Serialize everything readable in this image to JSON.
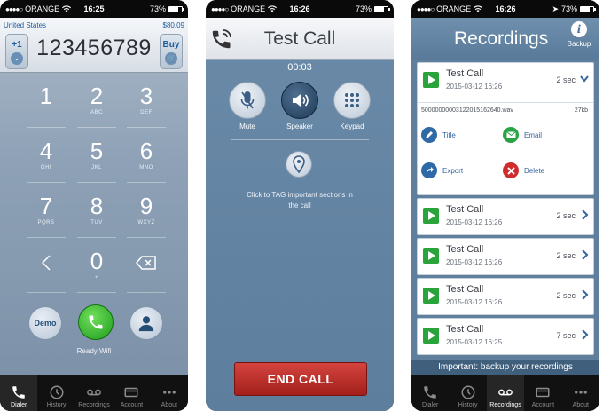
{
  "status_bars": [
    {
      "carrier": "ORANGE",
      "time": "16:25",
      "battery": "73%"
    },
    {
      "carrier": "ORANGE",
      "time": "16:26",
      "battery": "73%"
    },
    {
      "carrier": "ORANGE",
      "time": "16:26",
      "battery": "73%"
    }
  ],
  "dialer": {
    "country": "United States",
    "balance": "$80.09",
    "country_code": "+1",
    "buy_label": "Buy",
    "number": "123456789",
    "keys": [
      {
        "digit": "1",
        "letters": ""
      },
      {
        "digit": "2",
        "letters": "ABC"
      },
      {
        "digit": "3",
        "letters": "DEF"
      },
      {
        "digit": "4",
        "letters": "GHI"
      },
      {
        "digit": "5",
        "letters": "JKL"
      },
      {
        "digit": "6",
        "letters": "MNO"
      },
      {
        "digit": "7",
        "letters": "PQRS"
      },
      {
        "digit": "8",
        "letters": "TUV"
      },
      {
        "digit": "9",
        "letters": "WXYZ"
      },
      {
        "digit": "0",
        "letters": "+"
      }
    ],
    "demo_label": "Demo",
    "status_text": "Ready Wifi"
  },
  "tabbar_dialer": [
    "Dialer",
    "History",
    "Recordings",
    "Account",
    "About"
  ],
  "tabbar_recordings": [
    "Dialer",
    "History",
    "Recordings",
    "Account",
    "About"
  ],
  "test_call": {
    "title": "Test Call",
    "timer": "00:03",
    "controls": [
      "Mute",
      "Speaker",
      "Keypad"
    ],
    "tag_hint": "Click to TAG important sections in the call",
    "end_call": "END CALL"
  },
  "recordings": {
    "title": "Recordings",
    "backup_label": "Backup",
    "expanded": {
      "name": "Test Call",
      "date": "2015-03-12 16:26",
      "duration": "2 sec",
      "file": "50000000003122015162640.wav",
      "size": "27kb",
      "actions": [
        "Title",
        "Email",
        "Export",
        "Delete"
      ]
    },
    "items": [
      {
        "name": "Test Call",
        "date": "2015-03-12 16:26",
        "duration": "2 sec"
      },
      {
        "name": "Test Call",
        "date": "2015-03-12 16:26",
        "duration": "2 sec"
      },
      {
        "name": "Test Call",
        "date": "2015-03-12 16:26",
        "duration": "2 sec"
      },
      {
        "name": "Test Call",
        "date": "2015-03-12 16:25",
        "duration": "7 sec"
      }
    ],
    "banner": "Important: backup your recordings"
  },
  "colors": {
    "call_green": "#1f9a1d",
    "end_call_red": "#c0302b",
    "link_blue": "#3465a0",
    "play_green": "#29a33a"
  }
}
